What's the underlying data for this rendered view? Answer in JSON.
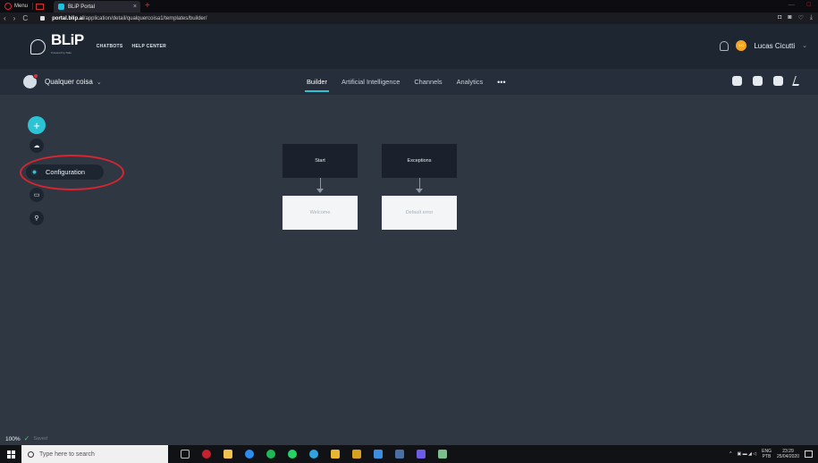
{
  "browser": {
    "menu_label": "Menu",
    "tab_title": "BLiP Portal",
    "tab_close": "×",
    "new_tab": "+",
    "url_host": "portal.blip.ai",
    "url_path": "/application/detail/qualquercoisa1/templates/builder/",
    "nav_back": "‹",
    "nav_forward": "›",
    "nav_reload": "C"
  },
  "header": {
    "logo_text": "BLiP",
    "logo_sub": "Powered by Take",
    "links": [
      "CHATBOTS",
      "HELP CENTER"
    ],
    "user_initials": "LC",
    "user_name": "Lucas Cicutti",
    "user_chevron": "⌄"
  },
  "botbar": {
    "bot_name": "Qualquer coisa",
    "bot_chevron": "⌄",
    "tabs": [
      "Builder",
      "Artificial Intelligence",
      "Channels",
      "Analytics"
    ],
    "more": "•••"
  },
  "sidebar": {
    "add": "+",
    "config_label": "Configuration"
  },
  "canvas": {
    "cards": [
      {
        "title": "Start",
        "block": "Welcome"
      },
      {
        "title": "Exceptions",
        "block": "Default error"
      }
    ],
    "zoom": "100%",
    "saved_label": "Saved"
  },
  "taskbar": {
    "search_placeholder": "Type here to search",
    "lang": "ENG",
    "lang2": "PTB",
    "time": "23:29",
    "date": "25/04/2020"
  },
  "colors": {
    "accent": "#2cc3d5",
    "highlight": "#d92530",
    "avatar": "#f5a623"
  }
}
